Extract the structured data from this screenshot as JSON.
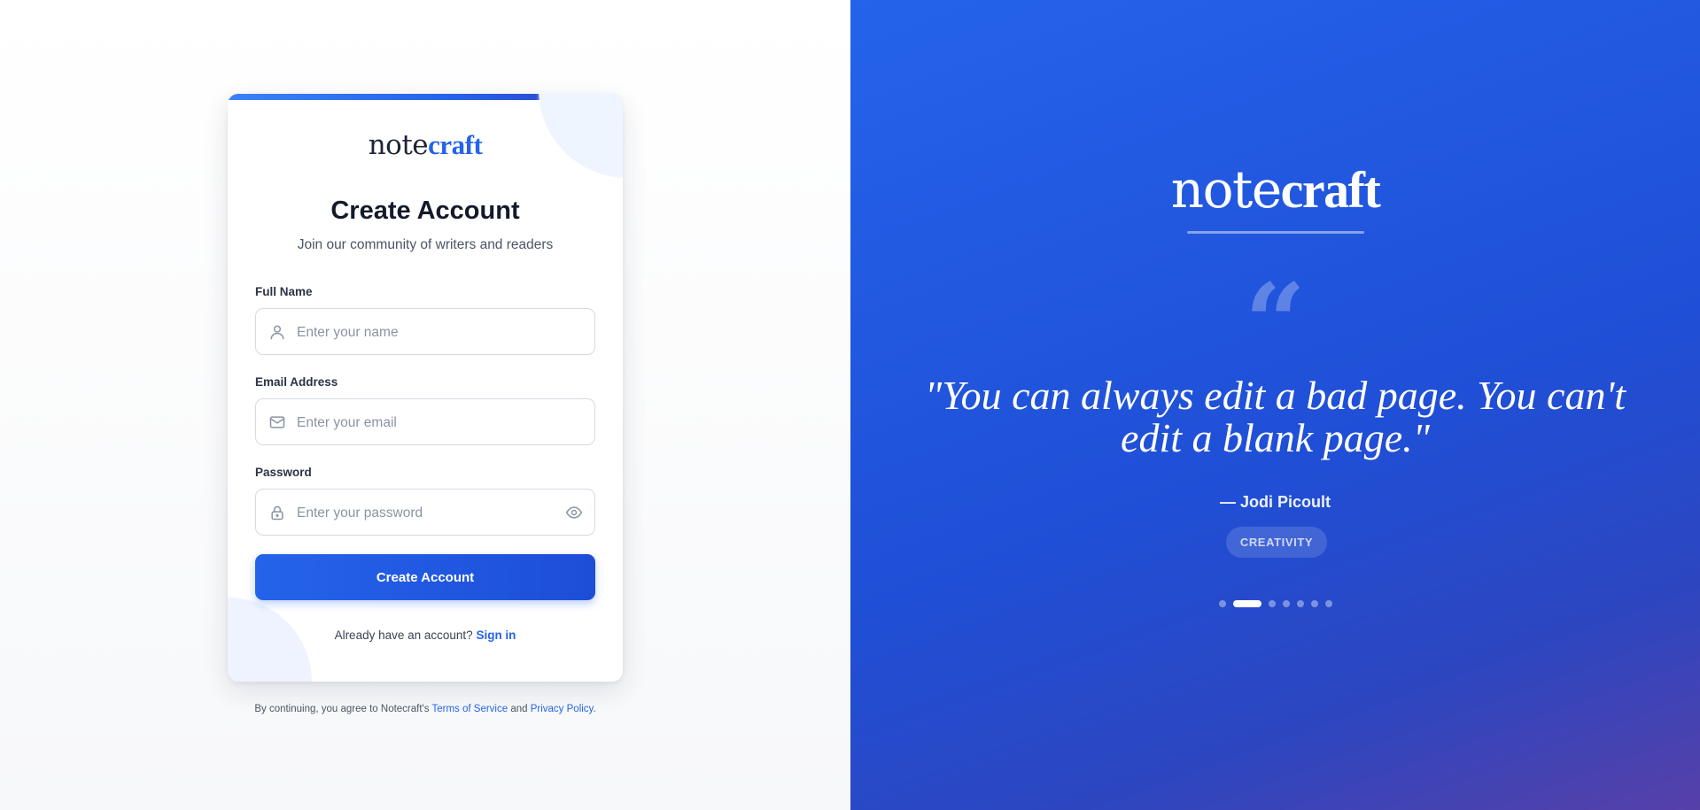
{
  "brand": {
    "part1": "note",
    "part2": "craft"
  },
  "form": {
    "title": "Create Account",
    "subtitle": "Join our community of writers and readers",
    "name_label": "Full Name",
    "name_placeholder": "Enter your name",
    "email_label": "Email Address",
    "email_placeholder": "Enter your email",
    "password_label": "Password",
    "password_placeholder": "Enter your password",
    "submit_label": "Create Account",
    "signin_prompt": "Already have an account?",
    "signin_link": "Sign in"
  },
  "terms": {
    "prefix": "By continuing, you agree to Notecraft's",
    "tos": "Terms of Service",
    "and": "and",
    "privacy": "Privacy Policy",
    "suffix": "."
  },
  "quote": {
    "text": "\"You can always edit a bad page. You can't edit a blank page.\"",
    "author": "— Jodi Picoult",
    "tag": "CREATIVITY",
    "total_slides": 7,
    "active_slide": 2
  },
  "icons": {
    "name_field": "user-icon",
    "email_field": "mail-icon",
    "password_field": "lock-icon",
    "password_toggle": "eye-icon",
    "quote": "quote-icon"
  },
  "colors": {
    "accent": "#2563eb",
    "panel_start": "#2563eb",
    "panel_end": "#5740a8"
  }
}
